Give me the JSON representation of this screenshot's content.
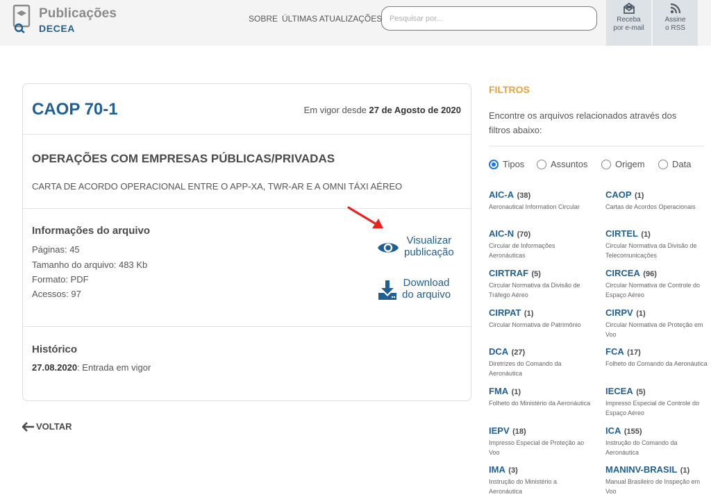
{
  "header": {
    "logo_top": "Publicações",
    "logo_bottom": "DECEA",
    "nav": [
      {
        "label": "SOBRE"
      },
      {
        "label": "ÚLTIMAS ATUALIZAÇÕES"
      }
    ],
    "search_placeholder": "Pesquisar por...",
    "email_label": "Receba\npor e-mail",
    "email_icon": "envelope-icon",
    "rss_label": "Assine\no RSS",
    "rss_icon": "rss-icon"
  },
  "document": {
    "code": "CAOP 70-1",
    "status_prefix": "Em vigor desde",
    "status_date": "27 de Agosto de 2020",
    "title": "OPERAÇÕES COM EMPRESAS PÚBLICAS/PRIVADAS",
    "description": "CARTA DE ACORDO OPERACIONAL ENTRE O APP-XA, TWR-AR E A OMNI TÁXI AÉREO",
    "info_title": "Informações do arquivo",
    "pages": "Páginas: 45",
    "size": "Tamanho do arquivo: 483 Kb",
    "format": "Formato: PDF",
    "accesses": "Acessos: 97",
    "view_label_1": "Visualizar",
    "view_label_2": "publicação",
    "download_label_1": "Download",
    "download_label_2": "do arquivo",
    "history_title": "Histórico",
    "history_date": "27.08.2020",
    "history_text": ": Entrada em vigor"
  },
  "back_label": "VOLTAR",
  "filters": {
    "title": "FILTROS",
    "description": "Encontre os arquivos relacionados através dos filtros abaixo:",
    "radios": [
      {
        "label": "Tipos",
        "checked": true
      },
      {
        "label": "Assuntos",
        "checked": false
      },
      {
        "label": "Origem",
        "checked": false
      },
      {
        "label": "Data",
        "checked": false
      }
    ],
    "types": [
      {
        "code": "AIC-A",
        "count": "(38)",
        "desc": "Aeronautical Information Circular"
      },
      {
        "code": "CAOP",
        "count": "(1)",
        "desc": "Cartas de Acordos Operacionais"
      },
      {
        "code": "AIC-N",
        "count": "(70)",
        "desc": "Circular de Informações Aeronáuticas"
      },
      {
        "code": "CIRTEL",
        "count": "(1)",
        "desc": "Circular Normativa da Divisão de Telecomunicações"
      },
      {
        "code": "CIRTRAF",
        "count": "(5)",
        "desc": "Circular Normativa da Divisão de Tráfego Aéreo"
      },
      {
        "code": "CIRCEA",
        "count": "(96)",
        "desc": "Circular Normativa de Controle do Espaço Aéreo"
      },
      {
        "code": "CIRPAT",
        "count": "(1)",
        "desc": "Circular Normativa de Patrimônio"
      },
      {
        "code": "CIRPV",
        "count": "(1)",
        "desc": "Circular Normativa de Proteção em Voo"
      },
      {
        "code": "DCA",
        "count": "(27)",
        "desc": "Diretrizes do Comando da Aeronáutica"
      },
      {
        "code": "FCA",
        "count": "(17)",
        "desc": "Folheto do Comando da Aeronáutica"
      },
      {
        "code": "FMA",
        "count": "(1)",
        "desc": "Folheto do Ministério da Aeronáutica"
      },
      {
        "code": "IECEA",
        "count": "(5)",
        "desc": "Impresso Especial de Controle do Espaço Aéreo"
      },
      {
        "code": "IEPV",
        "count": "(18)",
        "desc": "Impresso Especial de Proteção ao Voo"
      },
      {
        "code": "ICA",
        "count": "(155)",
        "desc": "Instrução do Comando da Aeronáutica"
      },
      {
        "code": "IMA",
        "count": "(3)",
        "desc": "Instrução do Ministério a Aeronáutica"
      },
      {
        "code": "MANINV-BRASIL",
        "count": "(1)",
        "desc": "Manual Brasileiro de Inspeção em Voo"
      }
    ]
  },
  "colors": {
    "brand": "#1f5f94",
    "accent": "#f0a030",
    "annotation_arrow": "#e8231e"
  }
}
